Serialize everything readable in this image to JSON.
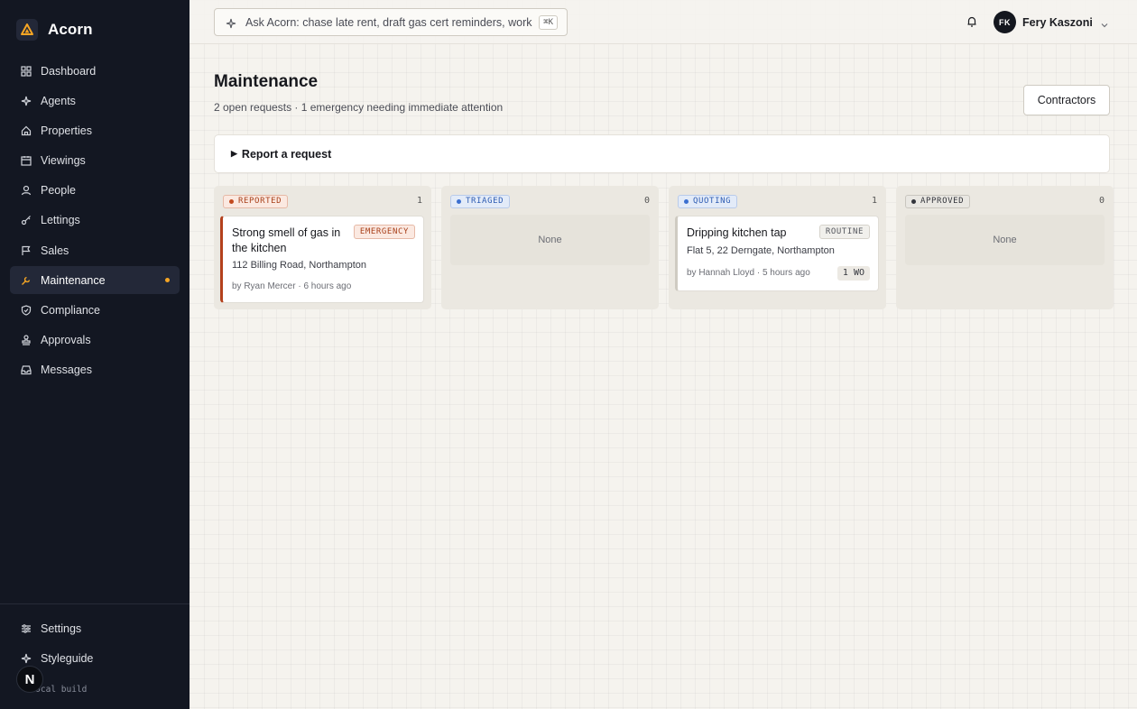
{
  "app": {
    "name": "Acorn"
  },
  "sidebar": {
    "items": [
      {
        "label": "Dashboard",
        "icon": "dashboard-icon"
      },
      {
        "label": "Agents",
        "icon": "sparkle-icon"
      },
      {
        "label": "Properties",
        "icon": "home-icon"
      },
      {
        "label": "Viewings",
        "icon": "calendar-icon"
      },
      {
        "label": "People",
        "icon": "person-icon"
      },
      {
        "label": "Lettings",
        "icon": "key-icon"
      },
      {
        "label": "Sales",
        "icon": "flag-icon"
      },
      {
        "label": "Maintenance",
        "icon": "wrench-icon",
        "active": true,
        "has_notification": true
      },
      {
        "label": "Compliance",
        "icon": "shield-icon"
      },
      {
        "label": "Approvals",
        "icon": "stamp-icon"
      },
      {
        "label": "Messages",
        "icon": "inbox-icon"
      }
    ],
    "bottom_items": [
      {
        "label": "Settings",
        "icon": "sliders-icon"
      },
      {
        "label": "Styleguide",
        "icon": "sparkle-icon"
      }
    ],
    "build_label": "· local build",
    "badge_letter": "N"
  },
  "topbar": {
    "search_text": "Ask Acorn: chase late rent, draft gas cert reminders, work th",
    "search_shortcut": "⌘K",
    "user": {
      "initials": "FK",
      "name": "Fery Kaszoni"
    }
  },
  "page": {
    "title": "Maintenance",
    "subtitle": "2 open requests · 1 emergency needing immediate attention",
    "contractors_button": "Contractors",
    "report_toggle": "Report a request"
  },
  "board": {
    "columns": [
      {
        "status": "REPORTED",
        "count": "1",
        "colors": {
          "bg": "#fbe9e1",
          "fg": "#a8401a",
          "border": "#e6b9a6",
          "dot": "#c24a1f"
        },
        "cards": [
          {
            "title": "Strong smell of gas in the kitchen",
            "tag": "EMERGENCY",
            "address": "112 Billing Road, Northampton",
            "meta": "by Ryan Mercer · 6 hours ago"
          }
        ]
      },
      {
        "status": "TRIAGED",
        "count": "0",
        "colors": {
          "bg": "#e3ebf8",
          "fg": "#2f5db3",
          "border": "#b9cbea",
          "dot": "#3b6fd0"
        },
        "empty_label": "None"
      },
      {
        "status": "QUOTING",
        "count": "1",
        "colors": {
          "bg": "#e3ebf8",
          "fg": "#2f5db3",
          "border": "#b9cbea",
          "dot": "#3b6fd0"
        },
        "cards": [
          {
            "title": "Dripping kitchen tap",
            "tag": "ROUTINE",
            "address": "Flat 5, 22 Derngate, Northampton",
            "meta": "by Hannah Lloyd · 5 hours ago",
            "wo": "1 WO"
          }
        ]
      },
      {
        "status": "APPROVED",
        "count": "0",
        "colors": {
          "bg": "#e9e7e2",
          "fg": "#33353c",
          "border": "#c9c6bf",
          "dot": "#33353c"
        },
        "empty_label": "None"
      }
    ]
  }
}
